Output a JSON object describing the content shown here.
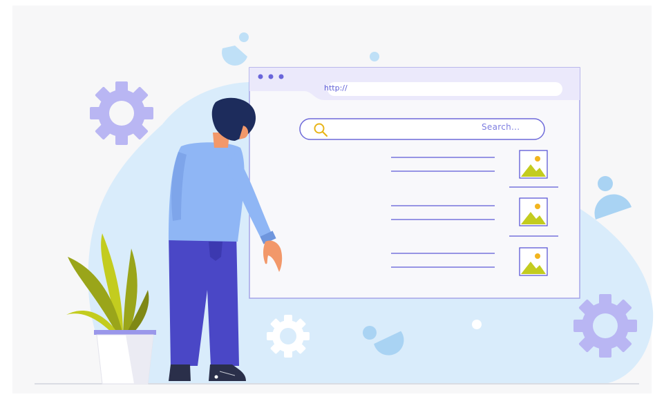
{
  "browser": {
    "url_text": "http://",
    "search_placeholder": "Search..."
  },
  "colors": {
    "background_blob": "#d9ecfb",
    "accent_purple": "#5b57d6",
    "gear_purple": "#b9b6f3",
    "shirt_blue": "#8fb6f5",
    "pants_indigo": "#4a47c6",
    "hair_navy": "#1d2c5c",
    "image_green": "#c3cc1f",
    "image_sun": "#f2b51e"
  },
  "icons": [
    "search-icon",
    "image-placeholder-icon",
    "gear-icon",
    "user-icon",
    "plant-illustration",
    "person-illustration"
  ]
}
